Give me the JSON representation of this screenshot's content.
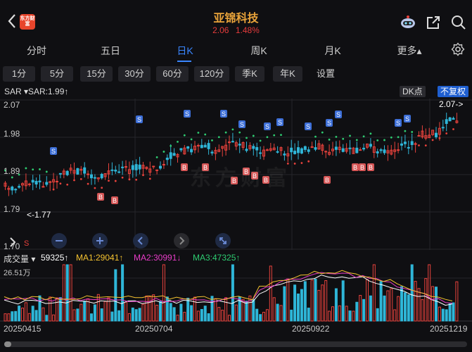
{
  "header": {
    "back_label": "back",
    "logo_text": "东方财富",
    "title": "亚锦科技",
    "price": "2.06",
    "change_pct": "1.48%"
  },
  "period_tabs": [
    "分时",
    "五日",
    "日K",
    "周K",
    "月K",
    "更多▴"
  ],
  "interval_buttons": [
    "1分",
    "5分",
    "15分",
    "30分",
    "60分",
    "120分",
    "季K",
    "年K",
    "设置"
  ],
  "indicator": {
    "name": "SAR",
    "value": "SAR:1.99↑",
    "dk": "DK点",
    "fq": "不复权"
  },
  "price_axis": [
    "2.07",
    "1.98",
    "1.89",
    "1.79",
    "1.70"
  ],
  "annotations": {
    "max": "2.07->",
    "min": "<-1.77"
  },
  "watermark": "东方财富",
  "volume": {
    "label": "成交量",
    "value": "59325↑",
    "ma1": "MA1:29041↑",
    "ma2": "MA2:30991↓",
    "ma3": "MA3:47325↑",
    "unit": "26.51万"
  },
  "dates": [
    "20250415",
    "20250704",
    "20250922",
    "20251219"
  ],
  "sar_marks": {
    "S": "S",
    "B": "B"
  },
  "colors": {
    "up": "#e8423c",
    "down": "#2fb6d8",
    "sar_up": "#e8423c",
    "sar_down": "#2ecc71",
    "ma1": "#ffffff",
    "ma2": "#e83cc8",
    "ma3": "#f5c330",
    "accent": "#3a86ff",
    "title": "#e8a33a"
  }
}
